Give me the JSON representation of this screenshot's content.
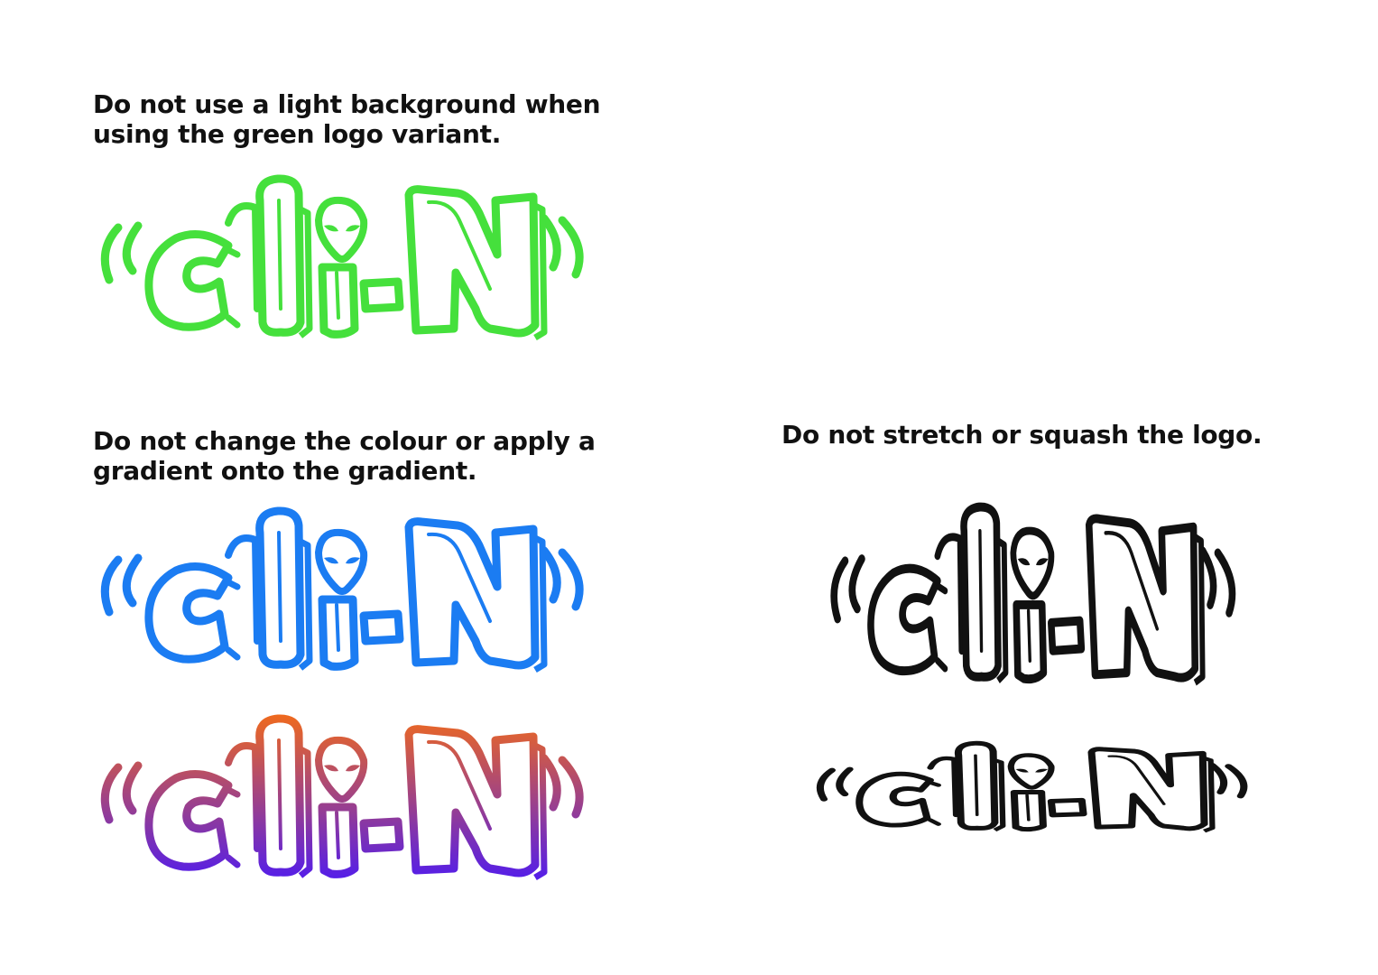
{
  "rules": {
    "green_background": {
      "line1": "Do not use a light background when",
      "line2": "using the green logo variant."
    },
    "colour_gradient": {
      "line1": "Do not change the colour or apply a",
      "line2": "gradient onto the gradient."
    },
    "stretch_squash": {
      "line1": "Do not stretch or squash the logo."
    }
  },
  "logo": {
    "wordmark": "cli-N",
    "icon": "alien-head-icon"
  },
  "colors": {
    "green": "#45e03c",
    "blue": "#1b7cf2",
    "gradient_top": "#f06a1c",
    "gradient_bottom": "#4f1bf0",
    "black": "#111111"
  }
}
